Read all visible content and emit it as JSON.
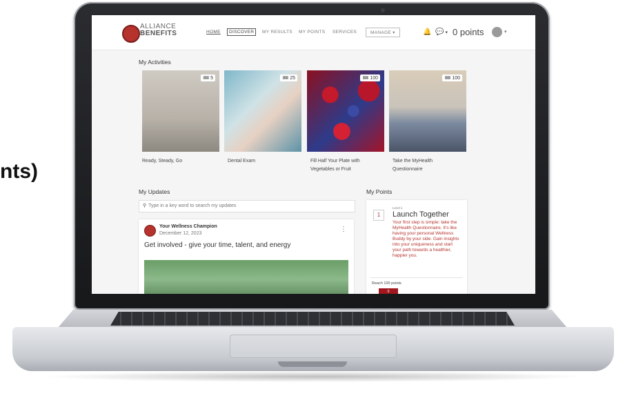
{
  "slide_text": "nts)",
  "app": {
    "logo_line1": "ALLIANCE",
    "logo_line2": "BENEFITS",
    "nav": [
      "HOME",
      "DISCOVER",
      "MY RESULTS",
      "MY POINTS",
      "SERVICES",
      "MANAGE ▾"
    ],
    "points_label": "0 points",
    "chat_caret": "▾",
    "avatar_caret": "▾",
    "bell_icon": "🔔",
    "chat_icon": "💬"
  },
  "activities": {
    "title": "My Activities",
    "items": [
      {
        "points": "5",
        "label": "Ready, Steady, Go"
      },
      {
        "points": "25",
        "label": "Dental Exam"
      },
      {
        "points": "100",
        "label": "Fill Half Your Plate with Vegetables or Fruit"
      },
      {
        "points": "100",
        "label": "Take the MyHealth Questionnaire"
      }
    ]
  },
  "updates": {
    "title": "My Updates",
    "search_placeholder": "Type in a key word to search my updates",
    "post": {
      "author": "Your Wellness Champion",
      "date": "December 12, 2023",
      "title": "Get involved - give your time, talent, and energy"
    }
  },
  "points": {
    "title": "My Points",
    "level_number": "1",
    "level_label": "Level 1",
    "level_title": "Launch Together",
    "level_desc": "Your first step is simple: take the MyHealth Questionnaire. It's like having your personal Wellness Buddy by your side. Gain insights into your uniqueness and start your path towards a healthier, happier you.",
    "reach_text": "Reach 100 points",
    "progress_value": "0"
  }
}
